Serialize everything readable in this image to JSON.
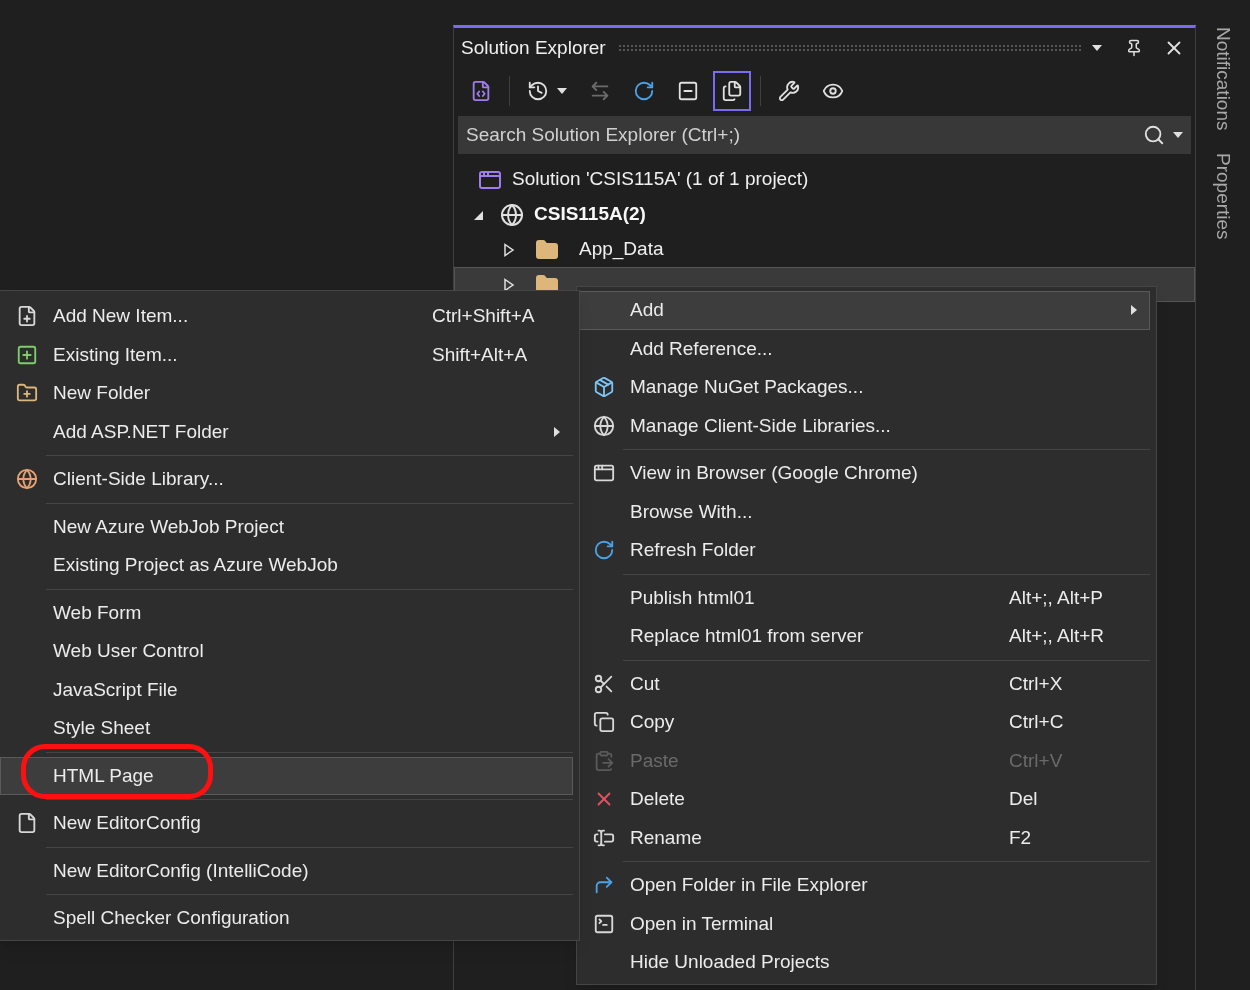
{
  "solution_explorer": {
    "title": "Solution Explorer",
    "toolbar": [
      {
        "selected": false,
        "disabled": false
      },
      {
        "selected": false,
        "disabled": false
      },
      {
        "selected": false,
        "disabled": true
      },
      {
        "selected": false,
        "disabled": false
      },
      {
        "selected": false,
        "disabled": false
      },
      {
        "selected": true,
        "disabled": false
      },
      {
        "selected": false,
        "disabled": false
      },
      {
        "selected": false,
        "disabled": false
      }
    ],
    "search": {
      "placeholder": "Search Solution Explorer (Ctrl+;)"
    },
    "tree": {
      "solution": {
        "label": "Solution 'CSIS115A' (1 of 1 project)"
      },
      "project": {
        "label": "CSIS115A(2)",
        "expanded": true,
        "children": [
          {
            "label": "App_Data",
            "expanded": false,
            "selected": false
          },
          {
            "expanded": false,
            "selected": true
          }
        ]
      }
    }
  },
  "side_tabs": [
    {
      "label": "Notifications"
    },
    {
      "label": "Properties"
    }
  ],
  "context_menu": {
    "groups": [
      [
        {
          "label": "Add",
          "submenu": true,
          "selected": true,
          "disabled": false
        },
        {
          "label": "Add Reference...",
          "selected": false,
          "disabled": false
        },
        {
          "label": "Manage NuGet Packages...",
          "selected": false,
          "disabled": false
        },
        {
          "label": "Manage Client-Side Libraries...",
          "selected": false,
          "disabled": false
        }
      ],
      [
        {
          "label": "View in Browser (Google Chrome)",
          "selected": false,
          "disabled": false
        },
        {
          "label": "Browse With...",
          "selected": false,
          "disabled": false
        },
        {
          "label": "Refresh Folder",
          "selected": false,
          "disabled": false
        }
      ],
      [
        {
          "label": "Publish html01",
          "shortcut": "Alt+;, Alt+P",
          "selected": false,
          "disabled": false
        },
        {
          "label": "Replace html01 from server",
          "shortcut": "Alt+;, Alt+R",
          "selected": false,
          "disabled": false
        }
      ],
      [
        {
          "label": "Cut",
          "shortcut": "Ctrl+X",
          "selected": false,
          "disabled": false
        },
        {
          "label": "Copy",
          "shortcut": "Ctrl+C",
          "selected": false,
          "disabled": false
        },
        {
          "label": "Paste",
          "shortcut": "Ctrl+V",
          "selected": false,
          "disabled": true
        },
        {
          "label": "Delete",
          "shortcut": "Del",
          "selected": false,
          "disabled": false
        },
        {
          "label": "Rename",
          "shortcut": "F2",
          "selected": false,
          "disabled": false
        }
      ],
      [
        {
          "label": "Open Folder in File Explorer",
          "selected": false,
          "disabled": false
        },
        {
          "label": "Open in Terminal",
          "selected": false,
          "disabled": false
        },
        {
          "label": "Hide Unloaded Projects",
          "selected": false,
          "disabled": false
        }
      ]
    ]
  },
  "submenu": {
    "groups": [
      [
        {
          "label": "Add New Item...",
          "shortcut": "Ctrl+Shift+A",
          "selected": false,
          "disabled": false
        },
        {
          "label": "Existing Item...",
          "shortcut": "Shift+Alt+A",
          "selected": false,
          "disabled": false
        },
        {
          "label": "New Folder",
          "selected": false,
          "disabled": false
        },
        {
          "label": "Add ASP.NET Folder",
          "submenu": true,
          "selected": false,
          "disabled": false
        }
      ],
      [
        {
          "label": "Client-Side Library...",
          "selected": false,
          "disabled": false
        }
      ],
      [
        {
          "label": "New Azure WebJob Project",
          "selected": false,
          "disabled": false
        },
        {
          "label": "Existing Project as Azure WebJob",
          "selected": false,
          "disabled": false
        }
      ],
      [
        {
          "label": "Web Form",
          "selected": false,
          "disabled": false
        },
        {
          "label": "Web User Control",
          "selected": false,
          "disabled": false
        },
        {
          "label": "JavaScript File",
          "selected": false,
          "disabled": false
        },
        {
          "label": "Style Sheet",
          "selected": false,
          "disabled": false
        }
      ],
      [
        {
          "label": "HTML Page",
          "selected": true,
          "disabled": false,
          "circled": true
        }
      ],
      [
        {
          "label": "New EditorConfig",
          "selected": false,
          "disabled": false
        }
      ],
      [
        {
          "label": "New EditorConfig (IntelliCode)",
          "selected": false,
          "disabled": false
        }
      ],
      [
        {
          "label": "Spell Checker Configuration",
          "selected": false,
          "disabled": false
        }
      ]
    ]
  }
}
